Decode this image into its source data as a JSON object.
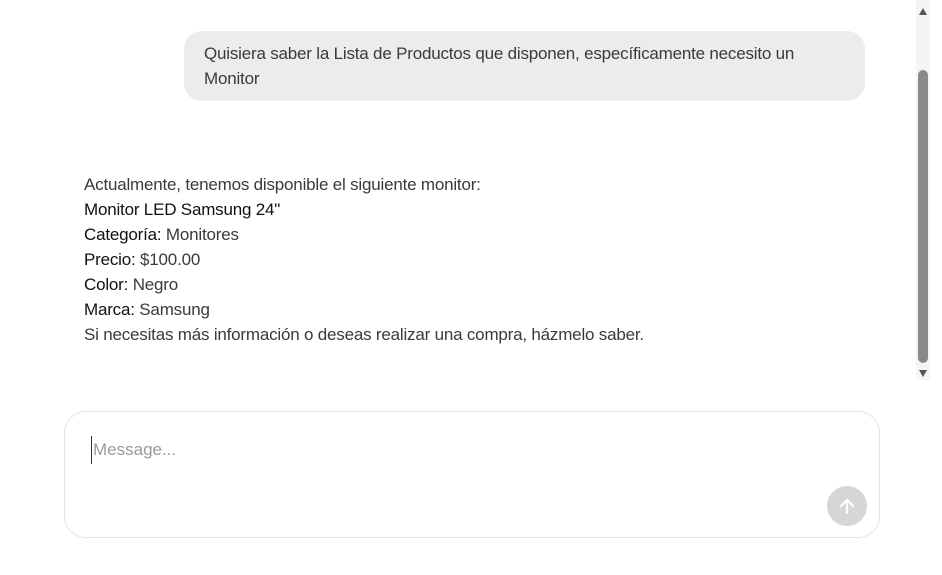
{
  "conversation": {
    "user_message": "Quisiera saber la Lista de Productos que disponen, específicamente necesito un Monitor",
    "assistant": {
      "intro": "Actualmente, tenemos disponible el siguiente monitor:",
      "product_name": "Monitor LED Samsung 24\"",
      "fields": [
        {
          "label": "Categoría:",
          "value": "Monitores"
        },
        {
          "label": "Precio:",
          "value": "$100.00"
        },
        {
          "label": "Color:",
          "value": "Negro"
        },
        {
          "label": "Marca:",
          "value": "Samsung"
        }
      ],
      "closing": "Si necesitas más información o deseas realizar una compra, házmelo saber."
    }
  },
  "composer": {
    "placeholder": "Message...",
    "value": "",
    "send_icon": "arrow-up-icon"
  },
  "colors": {
    "user_bubble": "#ececec",
    "send_button": "#d6d6d6",
    "scroll_thumb": "#8a8a8a"
  }
}
